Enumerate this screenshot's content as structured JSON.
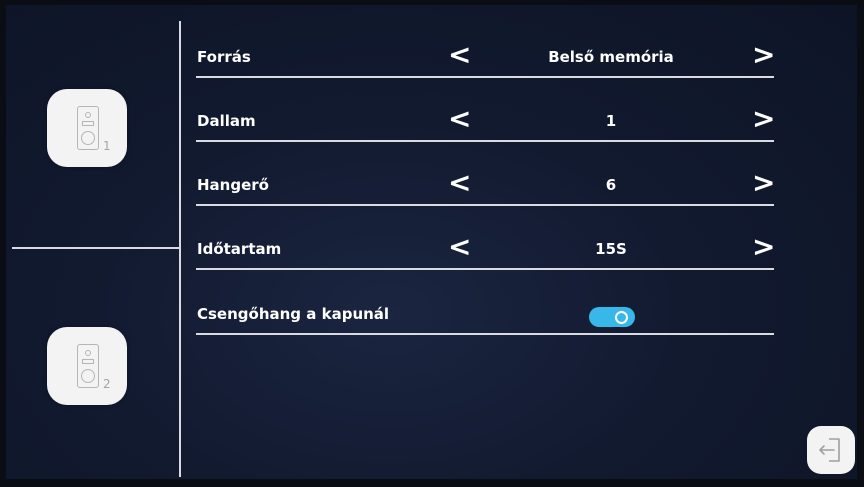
{
  "rows": [
    {
      "label": "Forrás",
      "value": "Belső memória",
      "prev": "<",
      "next": ">"
    },
    {
      "label": "Dallam",
      "value": "1",
      "prev": "<",
      "next": ">"
    },
    {
      "label": "Hangerő",
      "value": "6",
      "prev": "<",
      "next": ">"
    },
    {
      "label": "Időtartam",
      "value": "15S",
      "prev": "<",
      "next": ">"
    }
  ],
  "doorbell_toggle": {
    "label": "Csengőhang a kapunál",
    "state": "on"
  },
  "doors": [
    {
      "number": "1",
      "icon": "door-station-icon"
    },
    {
      "number": "2",
      "icon": "door-station-icon"
    }
  ],
  "exit": {
    "icon": "exit-icon"
  },
  "colors": {
    "accent": "#38b7ea",
    "background": "#121a30",
    "text": "#ffffff",
    "divider": "#d8dbe0"
  }
}
